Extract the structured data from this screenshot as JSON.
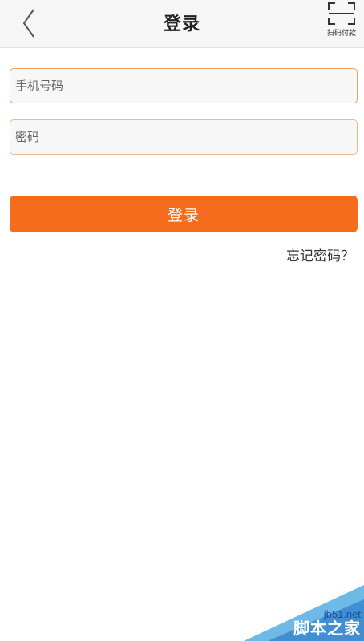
{
  "header": {
    "title": "登录",
    "scan_label": "扫码付款",
    "back_icon": "chevron-left-icon",
    "scan_icon": "scan-frame-icon"
  },
  "form": {
    "phone_placeholder": "手机号码",
    "password_placeholder": "密码",
    "login_label": "登录",
    "forgot_label": "忘记密码？"
  },
  "watermark": {
    "url": "jb51.net",
    "name": "脚本之家"
  },
  "colors": {
    "accent": "#f56c1d",
    "input_border": "#f2b88a",
    "header_bg": "#f6f6f6"
  }
}
